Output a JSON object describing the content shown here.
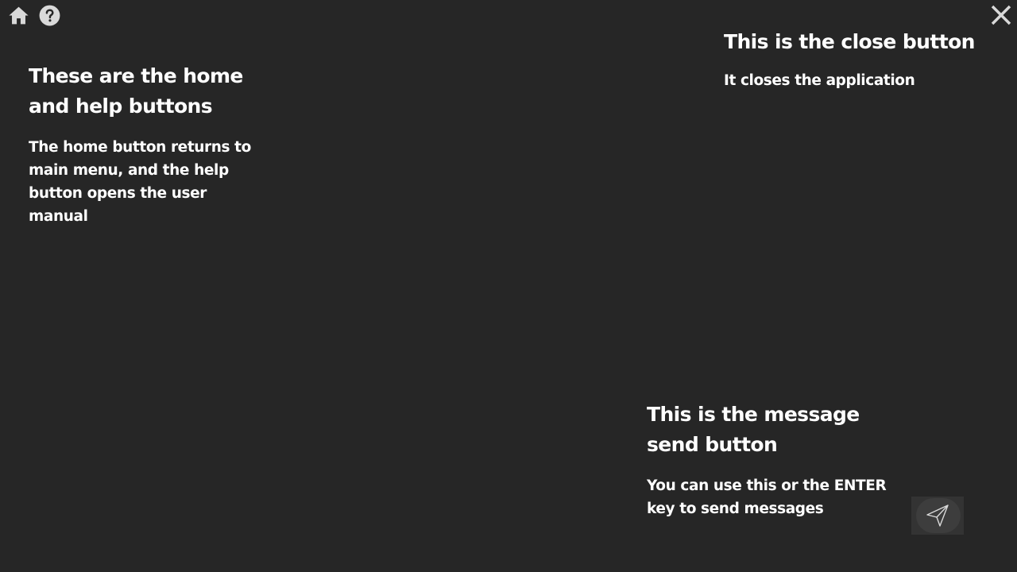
{
  "toolbar": {
    "home_icon": "home-icon",
    "help_icon": "help-icon",
    "close_icon": "close-icon"
  },
  "tips": {
    "home_help": {
      "title": "These are the home and help buttons",
      "body": "The home button returns to main menu, and the help button opens the user manual"
    },
    "close": {
      "title": "This is the close button",
      "body": "It closes the application"
    },
    "send": {
      "title": "This is the message send button",
      "body": "You can use this or the ENTER key to send messages"
    }
  },
  "send_button": {
    "icon": "paper-plane-icon"
  },
  "colors": {
    "background": "#262626",
    "text": "#ffffff",
    "icon": "#d9d9d9",
    "send_button_bg": "#333333"
  }
}
